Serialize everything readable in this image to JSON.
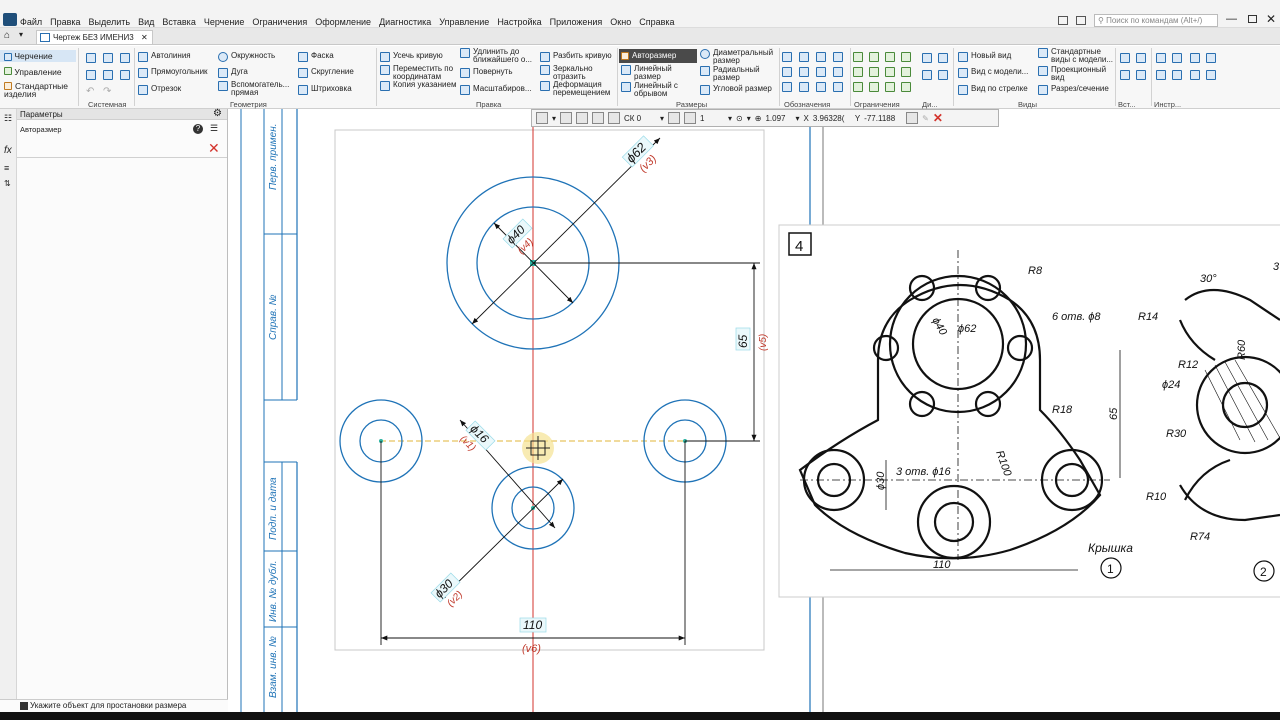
{
  "menubar": {
    "items": [
      "Файл",
      "Правка",
      "Выделить",
      "Вид",
      "Вставка",
      "Черчение",
      "Ограничения",
      "Оформление",
      "Диагностика",
      "Управление",
      "Настройка",
      "Приложения",
      "Окно",
      "Справка"
    ],
    "search_placeholder": "Поиск по командам (Alt+/)"
  },
  "tab": {
    "label": "Чертеж БЕЗ ИМЕНИ3"
  },
  "ribbon": {
    "side_modes": [
      "Черчение",
      "Управление",
      "Стандартные изделия"
    ],
    "groups": {
      "sistemnaya": "Системная",
      "geometriya": "Геометрия",
      "pravka": "Правка",
      "razmery": "Размеры",
      "oboznacheniya": "Обозначения",
      "ogranicheniya": "Ограничения",
      "di": "Ди...",
      "vidy": "Виды",
      "vst": "Вст...",
      "instr": "Инстр..."
    },
    "geometry": {
      "autoline": "Автолиния",
      "rectangle": "Прямоугольник",
      "segment": "Отрезок",
      "circle": "Окружность",
      "arc": "Дуга",
      "aux_line": "Вспомогатель... прямая",
      "chamfer": "Фаска",
      "fillet": "Скругление",
      "hatch": "Штриховка"
    },
    "edit": {
      "trim": "Усечь кривую",
      "move_coords": "Переместить по координатам",
      "copy_pointed": "Копия указанием",
      "extend": "Удлинить до ближайшего о...",
      "rotate": "Повернуть",
      "scale": "Масштабиров...",
      "split": "Разбить кривую",
      "mirror": "Зеркально отразить",
      "deform": "Деформация перемещением"
    },
    "dims": {
      "auto": "Авторазмер",
      "linear": "Линейный размер",
      "linear_break": "Линейный с обрывом",
      "diametral": "Диаметральный размер",
      "radial": "Радиальный размер",
      "angular": "Угловой размер"
    },
    "views": {
      "new_view": "Новый вид",
      "view_from_model": "Вид с модели...",
      "view_arrow": "Вид по стрелке",
      "std_views": "Стандартные виды с модели...",
      "proj_view": "Проекционный вид",
      "section": "Разрез/сечение"
    }
  },
  "panel": {
    "title": "Параметры",
    "subtitle": "Авторазмер"
  },
  "status": {
    "text": "Укажите объект для простановки размера"
  },
  "floating_toolbar": {
    "cs": "СК 0",
    "scale": "1",
    "zoom": "1.097",
    "x_label": "X",
    "x_value": "3.96328(",
    "y_label": "Y",
    "y_value": "-77.1188"
  },
  "drawing": {
    "dims": {
      "d62": "ϕ62",
      "v3": "(v3)",
      "d40": "ϕ40",
      "v4": "(v4)",
      "d16": "ϕ16",
      "v1": "(v1)",
      "d30": "ϕ30",
      "v2": "(v2)",
      "l65": "65",
      "v5": "(v5)",
      "l110": "110",
      "v6": "(v6)"
    },
    "title_block": [
      "Перв. примен.",
      "Справ. №",
      "Подп. и дата",
      "Инв. № дубл.",
      "Взам. инв. №"
    ]
  },
  "reference": {
    "sheet_no": "4",
    "labels": {
      "r8": "R8",
      "holes": "6 отв. ϕ8",
      "d40": "ϕ40",
      "d62": "ϕ62",
      "r18": "R18",
      "l65": "65",
      "d30": "ϕ30",
      "holes2": "3 отв. ϕ16",
      "r100": "R100",
      "l110": "110",
      "name": "Крышка",
      "n1": "1",
      "n2": "2",
      "a30": "30°",
      "r14": "R14",
      "r12": "R12",
      "r60": "R60",
      "d24": "ϕ24",
      "r30": "R30",
      "r10": "R10",
      "r74": "R74",
      "part3": "3"
    }
  },
  "colors": {
    "draw_blue": "#1f73b7",
    "axis_red": "#d3332c",
    "dim_label_red": "#c0392b",
    "accent": "#2a6fb0"
  }
}
